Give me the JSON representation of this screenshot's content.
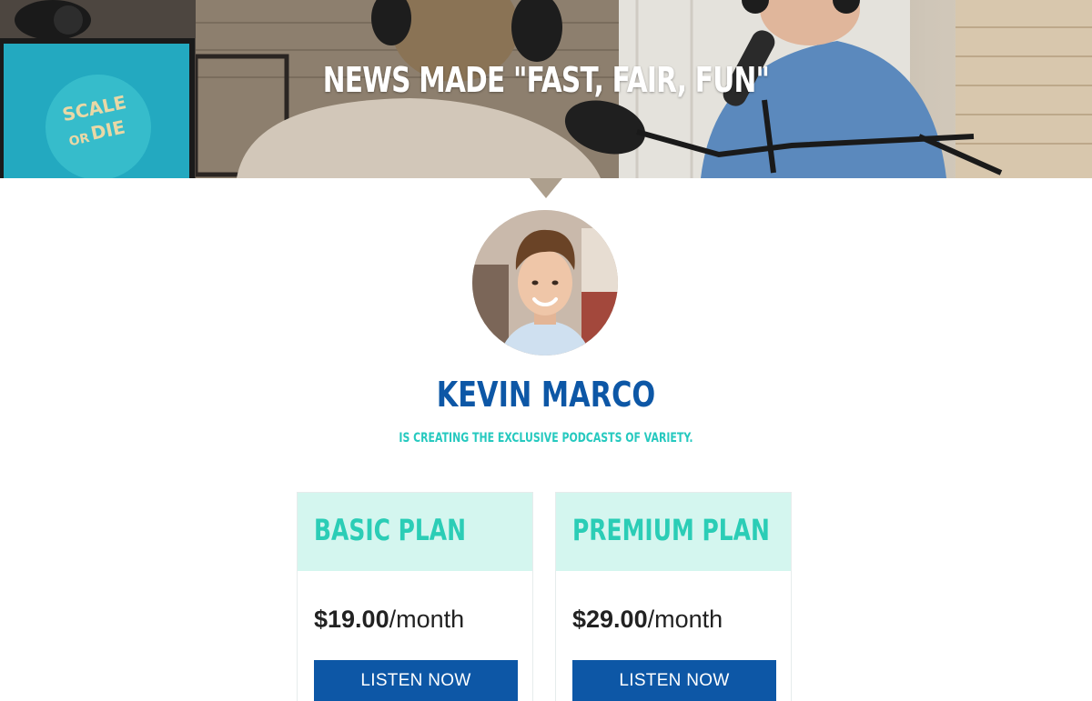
{
  "hero": {
    "title": "NEWS MADE \"FAST, FAIR, FUN\""
  },
  "profile": {
    "name": "KEVIN MARCO",
    "tagline": "IS CREATING THE EXCLUSIVE PODCASTS OF VARIETY."
  },
  "plans": [
    {
      "name": "BASIC PLAN",
      "price": "$19.00",
      "period": "/month",
      "button_label": "LISTEN NOW"
    },
    {
      "name": "PREMIUM PLAN",
      "price": "$29.00",
      "period": "/month",
      "button_label": "LISTEN NOW"
    }
  ],
  "colors": {
    "brand_blue": "#0d57a6",
    "accent_teal": "#26c9bf",
    "plan_header_bg": "#d4f6ef"
  },
  "hero_monitor_logo": {
    "line1": "SCALE",
    "line2": "OR",
    "line3": "DIE"
  }
}
